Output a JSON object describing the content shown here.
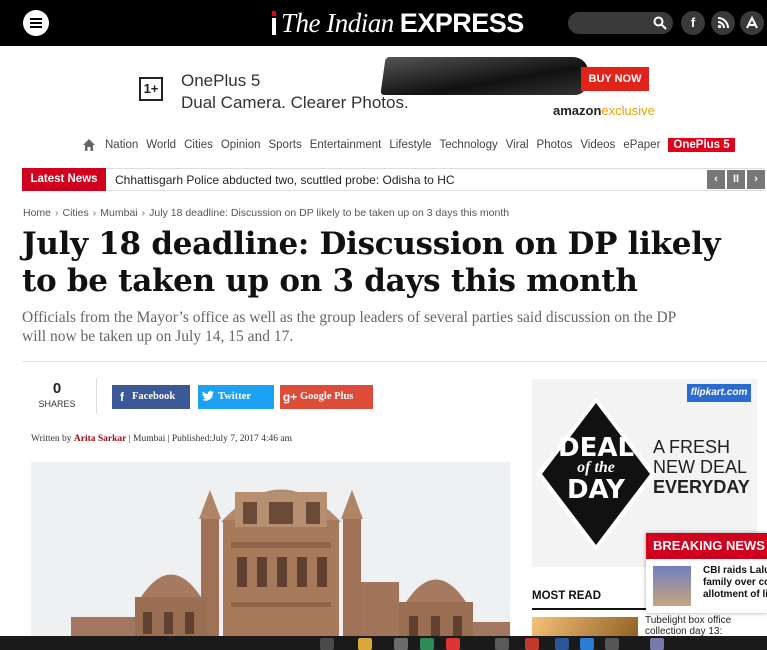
{
  "site": {
    "logo_the": "The Indian",
    "logo_express": "EXPRESS"
  },
  "header_icons": [
    "menu-icon",
    "search-icon",
    "facebook-icon",
    "rss-icon",
    "app-store-icon"
  ],
  "ad_banner": {
    "brand_mark": "1+",
    "line1": "OnePlus 5",
    "line2": "Dual Camera. Clearer Photos.",
    "cta": "BUY NOW",
    "amazon": "amazon",
    "exclusive": "exclusive"
  },
  "nav": {
    "items": [
      "Nation",
      "World",
      "Cities",
      "Opinion",
      "Sports",
      "Entertainment",
      "Lifestyle",
      "Technology",
      "Viral",
      "Photos",
      "Videos",
      "ePaper"
    ],
    "promo": "OnePlus 5"
  },
  "latest_news": {
    "tag": "Latest News",
    "headline": "Chhattisgarh Police abducted two, scuttled probe: Odisha to HC",
    "controls": [
      "‹",
      "II",
      "›"
    ]
  },
  "breadcrumb": [
    "Home",
    "Cities",
    "Mumbai",
    "July 18 deadline: Discussion on DP likely to be taken up on 3 days this month"
  ],
  "article": {
    "title": "July 18 deadline: Discussion on DP likely to be taken up on 3 days this month",
    "subtitle_line1": "Officials from the Mayor’s office as well as the group leaders of several parties said discussion on the DP",
    "subtitle_line2": "will now be taken up on July 14, 15 and 17.",
    "share_count": "0",
    "share_label": "SHARES",
    "share_buttons": [
      "Facebook",
      "Twitter",
      "Google Plus"
    ],
    "byline_prefix": "Written by",
    "author": "Arita Sarkar",
    "byline_rest": "| Mumbai | Published:July 7, 2017 4:46 am"
  },
  "right_ad": {
    "badge": "flipkart.com",
    "deal1": "DEAL",
    "deal2": "of the",
    "deal3": "DAY",
    "fresh1": "A FRESH",
    "fresh2": "NEW DEAL",
    "fresh3": "EVERYDAY"
  },
  "most_read": {
    "label": "MOST READ",
    "item_line1": "Tubelight box office",
    "item_line2": "collection day 13:"
  },
  "breaking": {
    "head": "BREAKING NEWS",
    "line1": "CBI raids Lalu",
    "line2": "family over co",
    "line3": "allotment of li"
  },
  "colors": {
    "brand_red": "#d1001e",
    "facebook": "#3b5998",
    "twitter": "#1da1f2",
    "google": "#dd4b39"
  }
}
